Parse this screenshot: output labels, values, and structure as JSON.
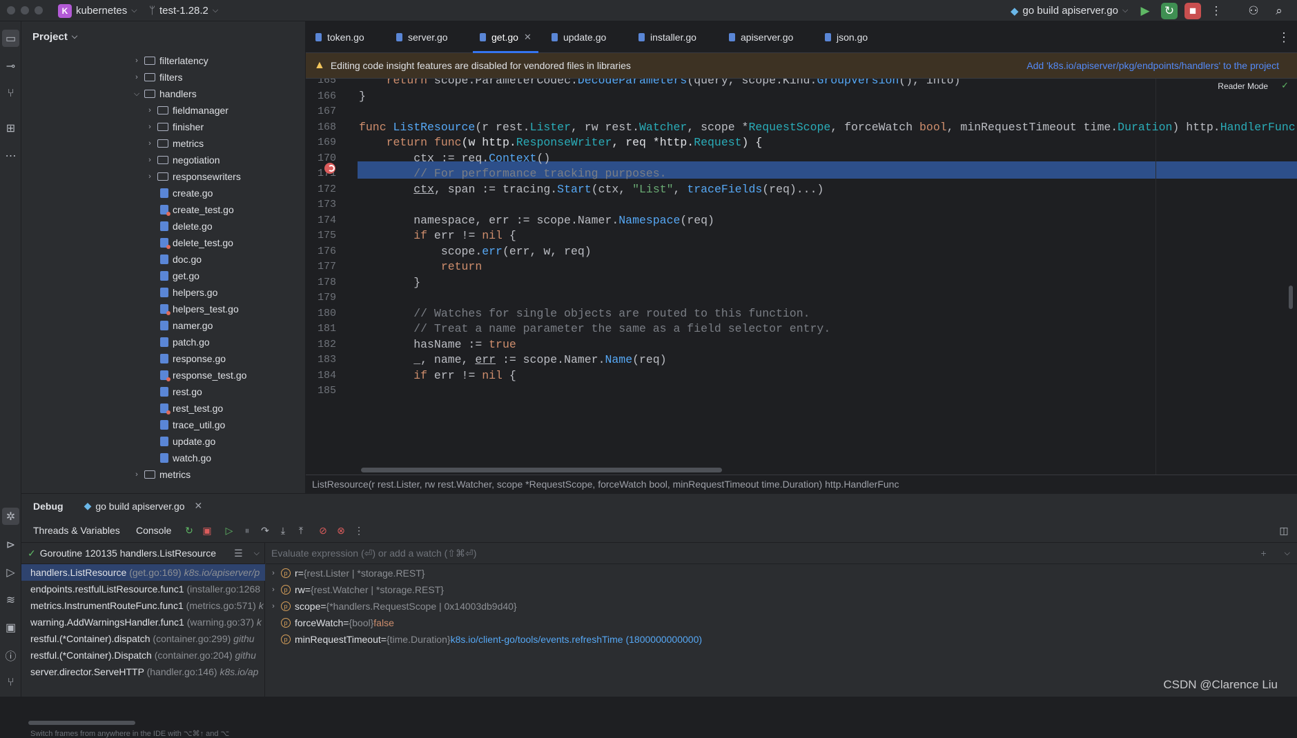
{
  "titlebar": {
    "project_badge": "K",
    "project_name": "kubernetes",
    "branch": "test-1.28.2",
    "run_config": "go build apiserver.go"
  },
  "project_panel": {
    "title": "Project",
    "tree": [
      {
        "label": "filterlatency",
        "kind": "folder",
        "depth": 0,
        "expanded": false
      },
      {
        "label": "filters",
        "kind": "folder",
        "depth": 0,
        "expanded": false
      },
      {
        "label": "handlers",
        "kind": "folder",
        "depth": 0,
        "expanded": true
      },
      {
        "label": "fieldmanager",
        "kind": "folder",
        "depth": 1,
        "expanded": false
      },
      {
        "label": "finisher",
        "kind": "folder",
        "depth": 1,
        "expanded": false
      },
      {
        "label": "metrics",
        "kind": "folder",
        "depth": 1,
        "expanded": false
      },
      {
        "label": "negotiation",
        "kind": "folder",
        "depth": 1,
        "expanded": false
      },
      {
        "label": "responsewriters",
        "kind": "folder",
        "depth": 1,
        "expanded": false
      },
      {
        "label": "create.go",
        "kind": "file",
        "depth": 1
      },
      {
        "label": "create_test.go",
        "kind": "test",
        "depth": 1
      },
      {
        "label": "delete.go",
        "kind": "file",
        "depth": 1
      },
      {
        "label": "delete_test.go",
        "kind": "test",
        "depth": 1
      },
      {
        "label": "doc.go",
        "kind": "file",
        "depth": 1
      },
      {
        "label": "get.go",
        "kind": "file",
        "depth": 1
      },
      {
        "label": "helpers.go",
        "kind": "file",
        "depth": 1
      },
      {
        "label": "helpers_test.go",
        "kind": "test",
        "depth": 1
      },
      {
        "label": "namer.go",
        "kind": "file",
        "depth": 1
      },
      {
        "label": "patch.go",
        "kind": "file",
        "depth": 1
      },
      {
        "label": "response.go",
        "kind": "file",
        "depth": 1
      },
      {
        "label": "response_test.go",
        "kind": "test",
        "depth": 1
      },
      {
        "label": "rest.go",
        "kind": "file",
        "depth": 1
      },
      {
        "label": "rest_test.go",
        "kind": "test",
        "depth": 1
      },
      {
        "label": "trace_util.go",
        "kind": "file",
        "depth": 1
      },
      {
        "label": "update.go",
        "kind": "file",
        "depth": 1
      },
      {
        "label": "watch.go",
        "kind": "file",
        "depth": 1
      },
      {
        "label": "metrics",
        "kind": "folder",
        "depth": 0,
        "expanded": false
      }
    ]
  },
  "tabs": [
    {
      "label": "token.go",
      "active": false
    },
    {
      "label": "server.go",
      "active": false
    },
    {
      "label": "get.go",
      "active": true
    },
    {
      "label": "update.go",
      "active": false
    },
    {
      "label": "installer.go",
      "active": false
    },
    {
      "label": "apiserver.go",
      "active": false
    },
    {
      "label": "json.go",
      "active": false
    }
  ],
  "banner": {
    "message": "Editing code insight features are disabled for vendored files in libraries",
    "action": "Add 'k8s.io/apiserver/pkg/endpoints/handlers' to the project"
  },
  "editor": {
    "reader_mode": "Reader Mode",
    "current_line": 169,
    "lines": [
      {
        "n": 165,
        "html": "    <span class='k'>return</span> scope.ParameterCodec.<span class='f'>DecodeParameters</span>(query, scope.Kind.<span class='f'>GroupVersion</span>(), into)"
      },
      {
        "n": 166,
        "html": "}"
      },
      {
        "n": 167,
        "html": ""
      },
      {
        "n": 168,
        "html": "<span class='k'>func</span> <span class='f'>ListResource</span>(r rest.<span class='t'>Lister</span>, rw rest.<span class='t'>Watcher</span>, scope *<span class='t'>RequestScope</span>, forceWatch <span class='k'>bool</span>, minRequestTimeout time.<span class='t'>Duration</span>) http.<span class='t'>HandlerFunc</span> {"
      },
      {
        "n": 169,
        "html": "    <span class='k'>return</span> <span class='k'>func</span>(w http.<span class='t'>ResponseWriter</span>, req *http.<span class='t'>Request</span>) {"
      },
      {
        "n": 170,
        "html": "        ctx := req.<span class='f'>Context</span>()"
      },
      {
        "n": 171,
        "html": "        <span class='c'>// For performance tracking purposes.</span>"
      },
      {
        "n": 172,
        "html": "        <u>ctx</u>, span := tracing.<span class='f'>Start</span>(ctx, <span class='s'>\"List\"</span>, <span class='f'>traceFields</span>(req)...)"
      },
      {
        "n": 173,
        "html": ""
      },
      {
        "n": 174,
        "html": "        namespace, err := scope.Namer.<span class='f'>Namespace</span>(req)"
      },
      {
        "n": 175,
        "html": "        <span class='k'>if</span> err != <span class='k'>nil</span> {"
      },
      {
        "n": 176,
        "html": "            scope.<span class='f'>err</span>(err, w, req)"
      },
      {
        "n": 177,
        "html": "            <span class='k'>return</span>"
      },
      {
        "n": 178,
        "html": "        }"
      },
      {
        "n": 179,
        "html": ""
      },
      {
        "n": 180,
        "html": "        <span class='c'>// Watches for single objects are routed to this function.</span>"
      },
      {
        "n": 181,
        "html": "        <span class='c'>// Treat a name parameter the same as a field selector entry.</span>"
      },
      {
        "n": 182,
        "html": "        hasName := <span class='k'>true</span>"
      },
      {
        "n": 183,
        "html": "        _, name, <u>err</u> := scope.Namer.<span class='f'>Name</span>(req)"
      },
      {
        "n": 184,
        "html": "        <span class='k'>if</span> err != <span class='k'>nil</span> {"
      },
      {
        "n": 185,
        "html": ""
      }
    ]
  },
  "breadcrumb": "ListResource(r rest.Lister, rw rest.Watcher, scope *RequestScope, forceWatch bool, minRequestTimeout time.Duration) http.HandlerFunc",
  "debug": {
    "title": "Debug",
    "session": "go build apiserver.go",
    "tab_threads": "Threads & Variables",
    "tab_console": "Console",
    "goroutine": "Goroutine 120135 handlers.ListResource",
    "eval_placeholder": "Evaluate expression (⏎) or add a watch (⇧⌘⏎)",
    "frames": [
      {
        "fn": "handlers.ListResource",
        "loc": "(get.go:169)",
        "pkg": "k8s.io/apiserver/p",
        "selected": true
      },
      {
        "fn": "endpoints.restfulListResource.func1",
        "loc": "(installer.go:1268",
        "pkg": "",
        "selected": false
      },
      {
        "fn": "metrics.InstrumentRouteFunc.func1",
        "loc": "(metrics.go:571)",
        "pkg": "k",
        "selected": false
      },
      {
        "fn": "warning.AddWarningsHandler.func1",
        "loc": "(warning.go:37)",
        "pkg": "k",
        "selected": false
      },
      {
        "fn": "restful.(*Container).dispatch",
        "loc": "(container.go:299)",
        "pkg": "githu",
        "selected": false
      },
      {
        "fn": "restful.(*Container).Dispatch",
        "loc": "(container.go:204)",
        "pkg": "githu",
        "selected": false
      },
      {
        "fn": "server.director.ServeHTTP",
        "loc": "(handler.go:146)",
        "pkg": "k8s.io/ap",
        "selected": false
      }
    ],
    "frames_hint": "Switch frames from anywhere in the IDE with ⌥⌘↑ and ⌥",
    "variables": [
      {
        "name": "r",
        "type": "{rest.Lister | *storage.REST}",
        "value": "",
        "expandable": true
      },
      {
        "name": "rw",
        "type": "{rest.Watcher | *storage.REST}",
        "value": "",
        "expandable": true
      },
      {
        "name": "scope",
        "type": "{*handlers.RequestScope | 0x14003db9d40}",
        "value": "",
        "expandable": true
      },
      {
        "name": "forceWatch",
        "type": "{bool}",
        "value": "false",
        "expandable": false
      },
      {
        "name": "minRequestTimeout",
        "type": "{time.Duration}",
        "value": "k8s.io/client-go/tools/events.refreshTime (1800000000000)",
        "expandable": false
      }
    ]
  },
  "watermark": "CSDN @Clarence Liu"
}
